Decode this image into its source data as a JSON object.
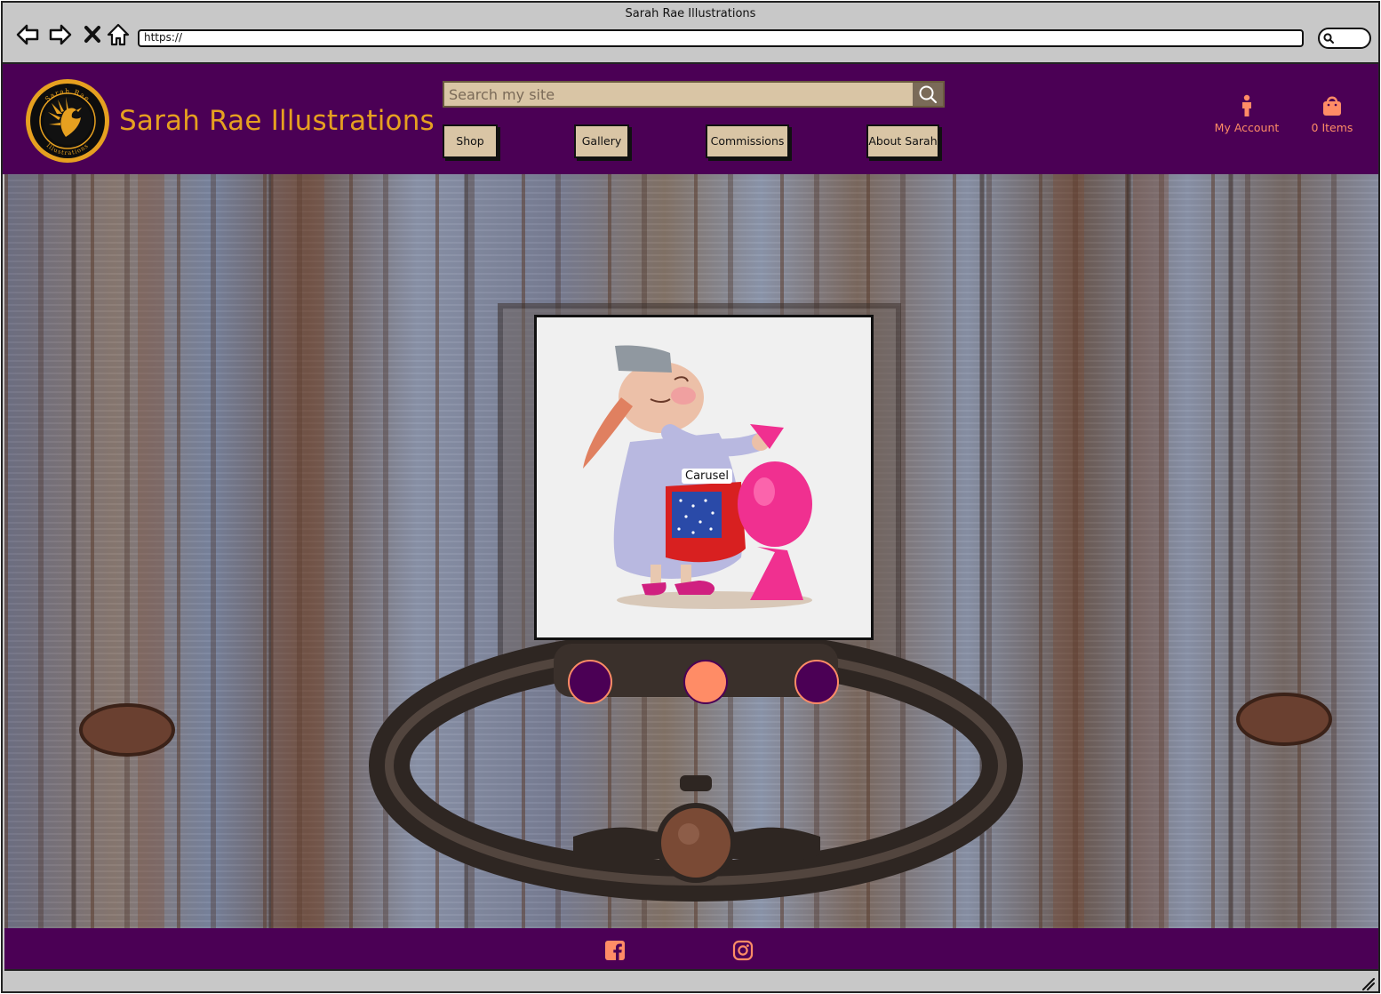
{
  "browser": {
    "window_title": "Sarah Rae Illustrations",
    "url": "https://"
  },
  "header": {
    "brand_name": "Sarah Rae Illustrations",
    "logo_text_top": "Sarah Rae",
    "logo_text_bottom": "Illustrations",
    "search": {
      "placeholder": "Search my site"
    },
    "nav": [
      {
        "label": "Shop"
      },
      {
        "label": "Gallery"
      },
      {
        "label": "Commissions"
      },
      {
        "label": "About Sarah"
      }
    ],
    "account_label": "My Account",
    "cart_label": "0 Items"
  },
  "hero": {
    "carousel_label": "Carusel",
    "slides": 3,
    "active_slide": 2
  },
  "footer": {
    "social": [
      "facebook-icon",
      "instagram-icon"
    ]
  },
  "colors": {
    "brand_purple": "#4b0055",
    "brand_gold": "#e6a020",
    "accent_coral": "#ff8c66",
    "tan": "#d9c5a5"
  }
}
